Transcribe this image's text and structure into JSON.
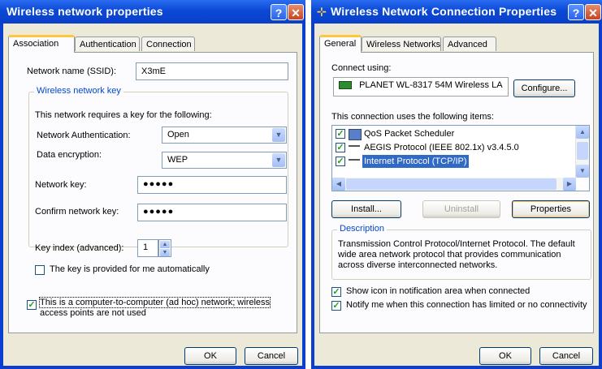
{
  "left_window": {
    "title": "Wireless network properties",
    "help": "?",
    "close": "✕",
    "tabs": [
      "Association",
      "Authentication",
      "Connection"
    ],
    "ssid_label": "Network name (SSID):",
    "ssid_value": "X3mE",
    "key_group": "Wireless network key",
    "requires_text": "This network requires a key for the following:",
    "auth_label": "Network Authentication:",
    "auth_value": "Open",
    "encryption_label": "Data encryption:",
    "encryption_value": "WEP",
    "key_label": "Network key:",
    "key_value": "●●●●●",
    "confirm_label": "Confirm network key:",
    "confirm_value": "●●●●●",
    "index_label": "Key index (advanced):",
    "index_value": "1",
    "auto_key_label": "The key is provided for me automatically",
    "adhoc_label_1": "This is a computer-to-computer (ad hoc) network; wireless",
    "adhoc_label_2": "access points are not used",
    "ok": "OK",
    "cancel": "Cancel"
  },
  "right_window": {
    "title": "Wireless Network Connection Properties",
    "help": "?",
    "close": "✕",
    "tabs": [
      "General",
      "Wireless Networks",
      "Advanced"
    ],
    "connect_using": "Connect using:",
    "adapter": "PLANET WL-8317 54M Wireless LA",
    "configure": "Configure...",
    "items_label": "This connection uses the following items:",
    "items": [
      "QoS Packet Scheduler",
      "AEGIS Protocol (IEEE 802.1x) v3.4.5.0",
      "Internet Protocol (TCP/IP)"
    ],
    "install": "Install...",
    "uninstall": "Uninstall",
    "properties": "Properties",
    "description_group": "Description",
    "description_lines": [
      "Transmission Control Protocol/Internet Protocol. The default",
      "wide area network protocol that provides communication",
      "across diverse interconnected networks."
    ],
    "show_icon": "Show icon in notification area when connected",
    "notify": "Notify me when this connection has limited or no connectivity",
    "ok": "OK",
    "cancel": "Cancel"
  }
}
